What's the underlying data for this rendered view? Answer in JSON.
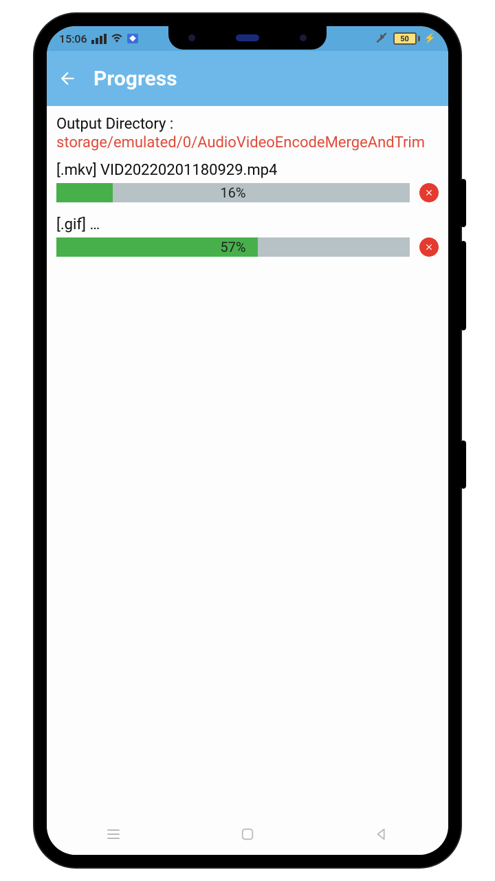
{
  "statusbar": {
    "time": "15:06",
    "battery_pct": "50",
    "bt_label": "❖"
  },
  "appbar": {
    "title": "Progress"
  },
  "output": {
    "label": "Output Directory :",
    "path": "storage/emulated/0/AudioVideoEncodeMergeAndTrim"
  },
  "tasks": [
    {
      "name": "[.mkv] VID20220201180929.mp4",
      "percent": 16,
      "percent_label": "16%"
    },
    {
      "name": "[.gif] …",
      "percent": 57,
      "percent_label": "57%"
    }
  ],
  "colors": {
    "appbar": "#6db8e8",
    "statusbar": "#5aa9dc",
    "progress_fill": "#47b04b",
    "progress_bg": "#b7c2c6",
    "cancel": "#e53a2f",
    "path": "#e04a3a"
  }
}
